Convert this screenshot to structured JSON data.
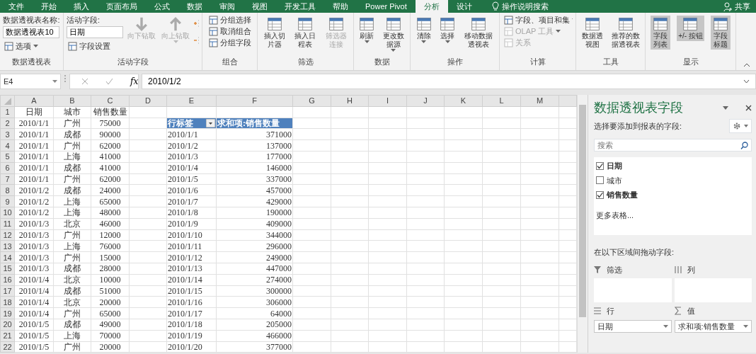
{
  "menu_tabs": [
    {
      "label": "文件",
      "selected": false
    },
    {
      "label": "开始",
      "selected": false
    },
    {
      "label": "插入",
      "selected": false
    },
    {
      "label": "页面布局",
      "selected": false
    },
    {
      "label": "公式",
      "selected": false
    },
    {
      "label": "数据",
      "selected": false
    },
    {
      "label": "审阅",
      "selected": false
    },
    {
      "label": "视图",
      "selected": false
    },
    {
      "label": "开发工具",
      "selected": false
    },
    {
      "label": "帮助",
      "selected": false
    },
    {
      "label": "Power Pivot",
      "selected": false
    },
    {
      "label": "分析",
      "selected": true
    },
    {
      "label": "设计",
      "selected": false
    }
  ],
  "tell_me": "操作说明搜索",
  "share": "共享",
  "ribbon_groups": [
    {
      "label": "数据透视表",
      "columns": [
        [
          {
            "kind": "caption",
            "label": "数据透视表名称:"
          },
          {
            "kind": "input",
            "value": "数据透视表10"
          },
          {
            "kind": "small",
            "label": "选项",
            "dropdown": true,
            "disabled": false
          }
        ]
      ]
    },
    {
      "label": "活动字段",
      "columns": [
        [
          {
            "kind": "caption",
            "label": "活动字段:"
          },
          {
            "kind": "input",
            "value": "日期"
          },
          {
            "kind": "small",
            "label": "字段设置",
            "dropdown": false,
            "disabled": false
          }
        ],
        [
          {
            "kind": "large",
            "label": "向下钻取",
            "dropdown": false,
            "disabled": true
          }
        ],
        [
          {
            "kind": "large",
            "label": "向上钻取",
            "dropdown": true,
            "disabled": true
          }
        ],
        [
          {
            "kind": "mini"
          },
          {
            "kind": "mini"
          }
        ]
      ]
    },
    {
      "label": "组合",
      "columns": [
        [
          {
            "kind": "small",
            "label": "分组选择",
            "dropdown": false,
            "disabled": false
          },
          {
            "kind": "small",
            "label": "取消组合",
            "dropdown": false,
            "disabled": false
          },
          {
            "kind": "small",
            "label": "分组字段",
            "dropdown": false,
            "disabled": false
          }
        ]
      ]
    },
    {
      "label": "筛选",
      "columns": [
        [
          {
            "kind": "large",
            "label": "插入切片器",
            "dropdown": false,
            "disabled": false
          }
        ],
        [
          {
            "kind": "large",
            "label": "插入日程表",
            "dropdown": false,
            "disabled": false
          }
        ],
        [
          {
            "kind": "large",
            "label": "筛选器连接",
            "dropdown": false,
            "disabled": true
          }
        ]
      ]
    },
    {
      "label": "数据",
      "columns": [
        [
          {
            "kind": "large",
            "label": "刷新",
            "dropdown": true,
            "disabled": false
          }
        ],
        [
          {
            "kind": "large",
            "label": "更改数据源",
            "dropdown": true,
            "disabled": false
          }
        ]
      ]
    },
    {
      "label": "操作",
      "columns": [
        [
          {
            "kind": "large",
            "label": "清除",
            "dropdown": true,
            "disabled": false
          }
        ],
        [
          {
            "kind": "large",
            "label": "选择",
            "dropdown": true,
            "disabled": false
          }
        ],
        [
          {
            "kind": "large",
            "label": "移动数据透视表",
            "dropdown": false,
            "disabled": false
          }
        ]
      ]
    },
    {
      "label": "计算",
      "columns": [
        [
          {
            "kind": "small",
            "label": "字段、项目和集",
            "dropdown": true,
            "disabled": false
          },
          {
            "kind": "small",
            "label": "OLAP 工具",
            "dropdown": true,
            "disabled": true
          },
          {
            "kind": "small",
            "label": "关系",
            "dropdown": false,
            "disabled": true
          }
        ]
      ]
    },
    {
      "label": "工具",
      "columns": [
        [
          {
            "kind": "large",
            "label": "数据透视图",
            "dropdown": false,
            "disabled": false
          }
        ],
        [
          {
            "kind": "large",
            "label": "推荐的数据透视表",
            "dropdown": false,
            "disabled": false
          }
        ]
      ]
    },
    {
      "label": "显示",
      "columns": [
        [
          {
            "kind": "toggle",
            "label": "字段列表",
            "on": true
          }
        ],
        [
          {
            "kind": "toggle",
            "label": "+/- 按钮",
            "on": true
          }
        ],
        [
          {
            "kind": "toggle",
            "label": "字段标题",
            "on": true
          }
        ]
      ]
    }
  ],
  "formula_bar": {
    "name_box": "E4",
    "fx_label": "fx",
    "value": "2010/1/2"
  },
  "sheet": {
    "columns": [
      "A",
      "B",
      "C",
      "D",
      "E",
      "F",
      "G",
      "H",
      "I",
      "J",
      "K",
      "L",
      "M"
    ],
    "row_numbers": [
      "1",
      "2",
      "3",
      "4",
      "5",
      "6",
      "7",
      "8",
      "9",
      "10",
      "11",
      "12",
      "13",
      "14",
      "15",
      "16",
      "17",
      "18",
      "19",
      "20",
      "21",
      "22"
    ],
    "source_table": {
      "header": [
        "日期",
        "城市",
        "销售数量"
      ],
      "rows": [
        [
          "2010/1/1",
          "广州",
          "75000"
        ],
        [
          "2010/1/1",
          "成都",
          "90000"
        ],
        [
          "2010/1/1",
          "广州",
          "62000"
        ],
        [
          "2010/1/1",
          "上海",
          "41000"
        ],
        [
          "2010/1/1",
          "成都",
          "41000"
        ],
        [
          "2010/1/1",
          "广州",
          "62000"
        ],
        [
          "2010/1/2",
          "成都",
          "24000"
        ],
        [
          "2010/1/2",
          "上海",
          "65000"
        ],
        [
          "2010/1/2",
          "上海",
          "48000"
        ],
        [
          "2010/1/3",
          "北京",
          "46000"
        ],
        [
          "2010/1/3",
          "广州",
          "12000"
        ],
        [
          "2010/1/3",
          "上海",
          "76000"
        ],
        [
          "2010/1/3",
          "广州",
          "15000"
        ],
        [
          "2010/1/3",
          "成都",
          "28000"
        ],
        [
          "2010/1/4",
          "北京",
          "10000"
        ],
        [
          "2010/1/4",
          "成都",
          "51000"
        ],
        [
          "2010/1/4",
          "北京",
          "20000"
        ],
        [
          "2010/1/4",
          "广州",
          "65000"
        ],
        [
          "2010/1/5",
          "成都",
          "49000"
        ],
        [
          "2010/1/5",
          "上海",
          "70000"
        ],
        [
          "2010/1/5",
          "广州",
          "20000"
        ]
      ]
    },
    "pivot_table": {
      "row_label_header": "行标签",
      "value_header": "求和项:销售数量",
      "rows": [
        [
          "2010/1/1",
          "371000"
        ],
        [
          "2010/1/2",
          "137000"
        ],
        [
          "2010/1/3",
          "177000"
        ],
        [
          "2010/1/4",
          "146000"
        ],
        [
          "2010/1/5",
          "337000"
        ],
        [
          "2010/1/6",
          "457000"
        ],
        [
          "2010/1/7",
          "429000"
        ],
        [
          "2010/1/8",
          "190000"
        ],
        [
          "2010/1/9",
          "409000"
        ],
        [
          "2010/1/10",
          "344000"
        ],
        [
          "2010/1/11",
          "296000"
        ],
        [
          "2010/1/12",
          "249000"
        ],
        [
          "2010/1/13",
          "447000"
        ],
        [
          "2010/1/14",
          "274000"
        ],
        [
          "2010/1/15",
          "300000"
        ],
        [
          "2010/1/16",
          "306000"
        ],
        [
          "2010/1/17",
          "64000"
        ],
        [
          "2010/1/18",
          "205000"
        ],
        [
          "2010/1/19",
          "466000"
        ],
        [
          "2010/1/20",
          "377000"
        ]
      ]
    }
  },
  "field_pane": {
    "title": "数据透视表字段",
    "subtitle": "选择要添加到报表的字段:",
    "search_placeholder": "搜索",
    "fields": [
      {
        "label": "日期",
        "checked": true
      },
      {
        "label": "城市",
        "checked": false
      },
      {
        "label": "销售数量",
        "checked": true
      }
    ],
    "more_tables": "更多表格...",
    "areas_caption": "在以下区域间拖动字段:",
    "areas": [
      {
        "kind": "filter",
        "label": "筛选"
      },
      {
        "kind": "columns",
        "label": "列"
      },
      {
        "kind": "rows",
        "label": "行",
        "items": [
          "日期"
        ]
      },
      {
        "kind": "values",
        "label": "值",
        "items": [
          "求和项:销售数量"
        ]
      }
    ]
  }
}
